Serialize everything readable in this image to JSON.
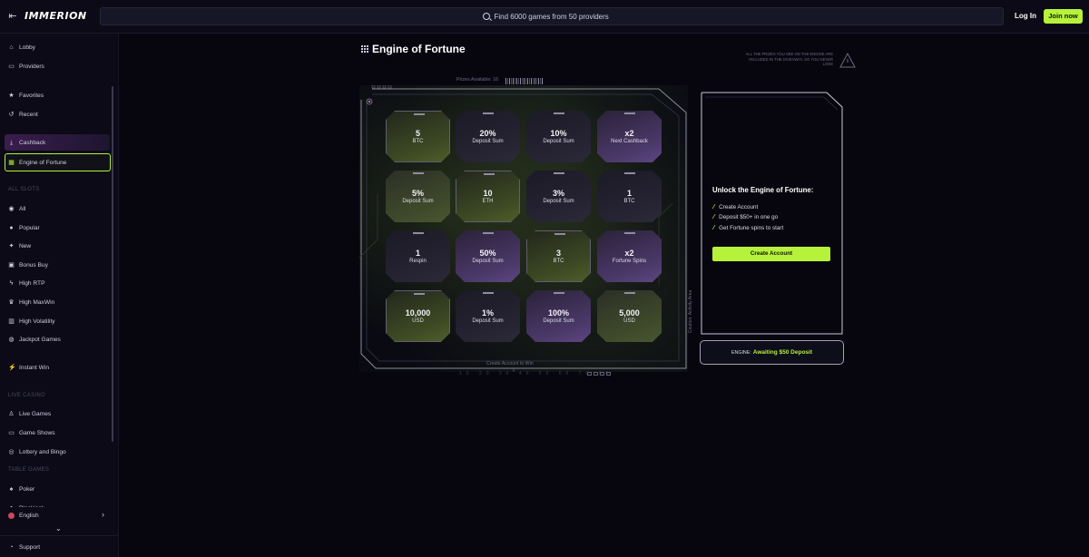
{
  "header": {
    "logo": "IMMERION",
    "search_placeholder": "Find 6000 games from 50 providers",
    "login": "Log In",
    "join": "Join now"
  },
  "sidebar": {
    "items_top": [
      {
        "label": "Lobby",
        "icon": "home-icon"
      },
      {
        "label": "Providers",
        "icon": "providers-icon"
      }
    ],
    "items_user": [
      {
        "label": "Favorites",
        "icon": "star-icon"
      },
      {
        "label": "Recent",
        "icon": "history-icon"
      }
    ],
    "items_promo": [
      {
        "label": "Cashback",
        "icon": "cashback-icon"
      },
      {
        "label": "Engine of Fortune",
        "icon": "grid-icon"
      }
    ],
    "section_slots": "ALL SLOTS",
    "items_slots": [
      {
        "label": "All",
        "icon": "all-icon"
      },
      {
        "label": "Popular",
        "icon": "popular-icon"
      },
      {
        "label": "New",
        "icon": "sparkle-icon"
      },
      {
        "label": "Bonus Buy",
        "icon": "bonus-icon"
      },
      {
        "label": "High RTP",
        "icon": "bolt-icon"
      },
      {
        "label": "High MaxWin",
        "icon": "trophy-icon"
      },
      {
        "label": "High Volatility",
        "icon": "chart-icon"
      },
      {
        "label": "Jackpot Games",
        "icon": "jackpot-icon"
      }
    ],
    "items_instant": [
      {
        "label": "Instant Win",
        "icon": "instant-icon"
      }
    ],
    "section_live": "LIVE CASINO",
    "items_live": [
      {
        "label": "Live Games",
        "icon": "dealer-icon"
      },
      {
        "label": "Game Shows",
        "icon": "tv-icon"
      },
      {
        "label": "Lottery and Bingo",
        "icon": "lottery-icon"
      }
    ],
    "section_table": "TABLE GAMES",
    "items_table": [
      {
        "label": "Poker",
        "icon": "cards-icon"
      },
      {
        "label": "Blackjack",
        "icon": "blackjack-icon"
      }
    ],
    "language": "English",
    "support": "Support"
  },
  "main": {
    "title": "Engine of Fortune",
    "disclaimer": "ALL THE PRIZES YOU SEE ON THE ENGINE ARE INCLUDED IN THE GIVEAWAY, SO YOU NEVER LOSE",
    "prizes_available": "Prizes Available: 16",
    "create_to_win": "Create Account to Win",
    "scale": "10 20 30 40 50 60 70 80",
    "caution": "Caution: Activity Area",
    "tiles": [
      {
        "value": "5",
        "unit": "BTC",
        "style": "green"
      },
      {
        "value": "20%",
        "unit": "Deposit Sum",
        "style": "dark"
      },
      {
        "value": "10%",
        "unit": "Deposit Sum",
        "style": "dark"
      },
      {
        "value": "x2",
        "unit": "Next Cashback",
        "style": "purple"
      },
      {
        "value": "5%",
        "unit": "Deposit Sum",
        "style": "mixgreen"
      },
      {
        "value": "10",
        "unit": "ETH",
        "style": "green"
      },
      {
        "value": "3%",
        "unit": "Deposit Sum",
        "style": "dark"
      },
      {
        "value": "1",
        "unit": "BTC",
        "style": "dark"
      },
      {
        "value": "1",
        "unit": "Respin",
        "style": "dark"
      },
      {
        "value": "50%",
        "unit": "Deposit Sum",
        "style": "purple"
      },
      {
        "value": "3",
        "unit": "BTC",
        "style": "green"
      },
      {
        "value": "x2",
        "unit": "Fortune Spins",
        "style": "purple"
      },
      {
        "value": "10,000",
        "unit": "USD",
        "style": "green"
      },
      {
        "value": "1%",
        "unit": "Deposit Sum",
        "style": "dark"
      },
      {
        "value": "100%",
        "unit": "Deposit Sum",
        "style": "purple"
      },
      {
        "value": "5,000",
        "unit": "USD",
        "style": "mixgreen"
      }
    ]
  },
  "panel": {
    "title": "Unlock the Engine of Fortune:",
    "steps": [
      "Create Account",
      "Deposit $50+ in one go",
      "Get Fortune spins to start"
    ],
    "cta": "Create Account",
    "status_key": "ENGINE:",
    "status_value": "Awaiting $50 Deposit"
  },
  "colors": {
    "accent": "#b6f23a",
    "background": "#07060f",
    "sidebar": "#0b0a16",
    "tile_purple": "#4a3868",
    "tile_green": "#3d4a24"
  }
}
